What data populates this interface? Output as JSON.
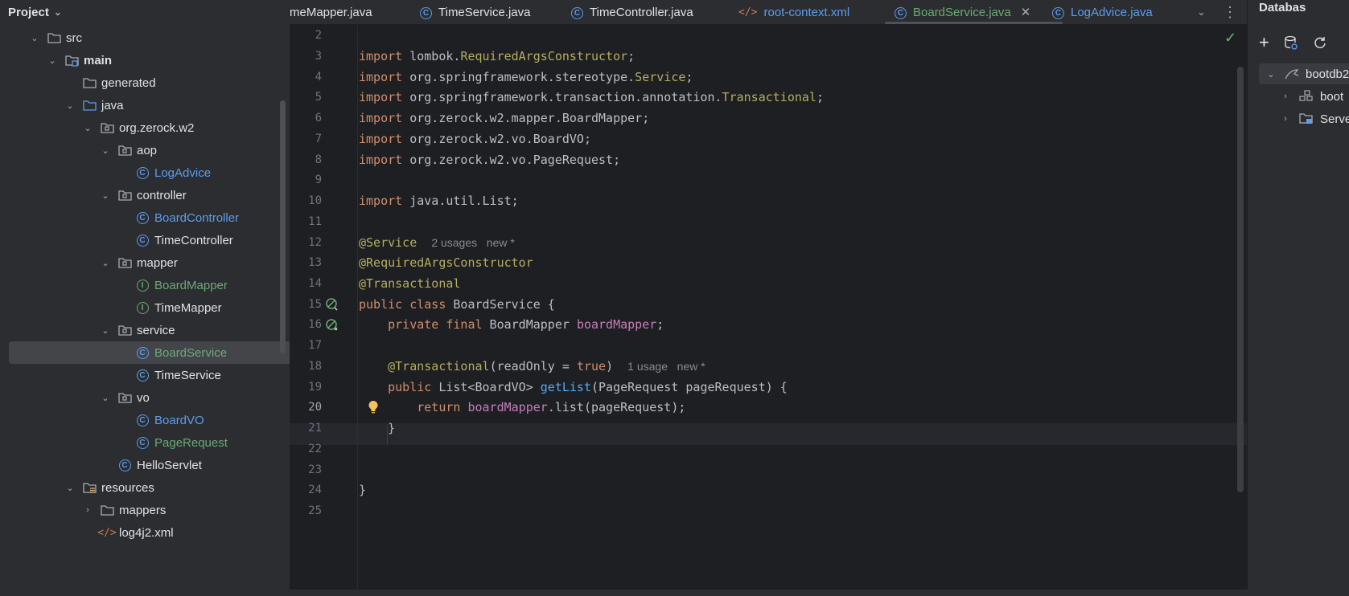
{
  "project_panel": {
    "title": "Project",
    "tree": [
      {
        "label": "src"
      },
      {
        "label": "main"
      },
      {
        "label": "generated"
      },
      {
        "label": "java"
      },
      {
        "label": "org.zerock.w2"
      },
      {
        "label": "aop"
      },
      {
        "label": "LogAdvice"
      },
      {
        "label": "controller"
      },
      {
        "label": "BoardController"
      },
      {
        "label": "TimeController"
      },
      {
        "label": "mapper"
      },
      {
        "label": "BoardMapper"
      },
      {
        "label": "TimeMapper"
      },
      {
        "label": "service"
      },
      {
        "label": "BoardService"
      },
      {
        "label": "TimeService"
      },
      {
        "label": "vo"
      },
      {
        "label": "BoardVO"
      },
      {
        "label": "PageRequest"
      },
      {
        "label": "HelloServlet"
      },
      {
        "label": "resources"
      },
      {
        "label": "mappers"
      },
      {
        "label": "log4j2.xml"
      }
    ]
  },
  "tabs": [
    {
      "label": "meMapper.java"
    },
    {
      "label": "TimeService.java"
    },
    {
      "label": "TimeController.java"
    },
    {
      "label": "root-context.xml"
    },
    {
      "label": "BoardService.java"
    },
    {
      "label": "LogAdvice.java"
    }
  ],
  "editor": {
    "line_numbers": [
      "2",
      "3",
      "4",
      "5",
      "6",
      "7",
      "8",
      "9",
      "10",
      "11",
      "12",
      "13",
      "14",
      "15",
      "16",
      "17",
      "18",
      "19",
      "20",
      "21",
      "22",
      "23",
      "24",
      "25"
    ],
    "current_line": "20",
    "lines": {
      "l3_kw": "import",
      "l3_pkg": " lombok.",
      "l3_cls": "RequiredArgsConstructor",
      "l3_end": ";",
      "l4_kw": "import",
      "l4_pkg": " org.springframework.stereotype.",
      "l4_cls": "Service",
      "l4_end": ";",
      "l5_kw": "import",
      "l5_pkg": " org.springframework.transaction.annotation.",
      "l5_cls": "Transactional",
      "l5_end": ";",
      "l6_kw": "import",
      "l6_rest": " org.zerock.w2.mapper.BoardMapper;",
      "l7_kw": "import",
      "l7_rest": " org.zerock.w2.vo.BoardVO;",
      "l8_kw": "import",
      "l8_rest": " org.zerock.w2.vo.PageRequest;",
      "l10_kw": "import",
      "l10_rest": " java.util.List;",
      "l12_ann": "@Service",
      "l12_hint": "2 usages   new *",
      "l13_ann": "@RequiredArgsConstructor",
      "l14_ann": "@Transactional",
      "l15_kw": "public class",
      "l15_rest": " BoardService {",
      "l16_kw": "private final",
      "l16_type": " BoardMapper ",
      "l16_fld": "boardMapper",
      "l16_end": ";",
      "l18_ann": "@Transactional",
      "l18_p1": "(readOnly = ",
      "l18_kw": "true",
      "l18_p2": ")",
      "l18_hint": "1 usage   new *",
      "l19_kw": "public",
      "l19_type": " List<BoardVO> ",
      "l19_fn": "getList",
      "l19_rest": "(PageRequest pageRequest) {",
      "l20_kw": "return",
      "l20_fld": " boardMapper",
      "l20_rest": ".list(pageRequest);",
      "l21": "}",
      "l24": "}"
    }
  },
  "database_panel": {
    "title": "Databas",
    "items": [
      {
        "label": "bootdb2"
      },
      {
        "label": "boot"
      },
      {
        "label": "Serve"
      }
    ]
  },
  "colors": {
    "keyword": "#cf8e6d",
    "annotation": "#b3ae60",
    "field": "#c77dbb",
    "function": "#56a8f5",
    "class_link": "#5c9ded",
    "modified_file": "#6aab73"
  }
}
